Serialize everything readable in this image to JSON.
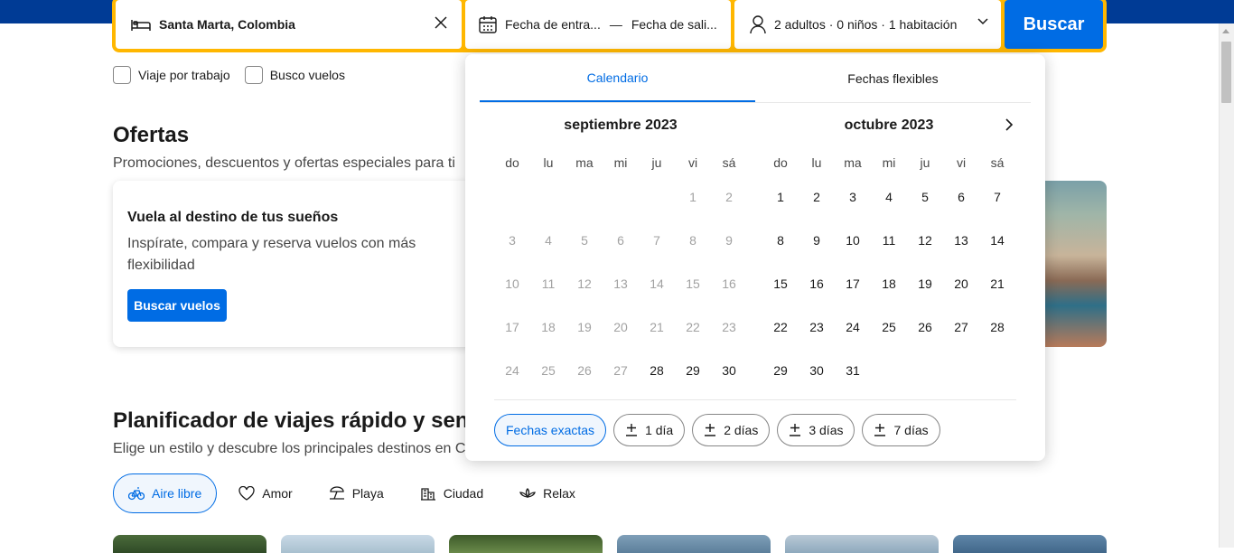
{
  "search": {
    "destination": "Santa Marta, Colombia",
    "checkin": "Fecha de entra...",
    "separator": "—",
    "checkout": "Fecha de sali...",
    "guests": "2 adultos · 0 niños · 1 habitación",
    "button": "Buscar",
    "icons": [
      "bed-icon",
      "close-icon",
      "calendar-icon",
      "person-icon",
      "chevron-down-icon"
    ]
  },
  "options": {
    "work_trip": "Viaje por trabajo",
    "flights": "Busco vuelos"
  },
  "offers": {
    "title": "Ofertas",
    "subtitle": "Promociones, descuentos y ofertas especiales para ti",
    "card_title": "Vuela al destino de tus sueños",
    "card_text": "Inspírate, compara y reserva vuelos con más flexibilidad",
    "card_button": "Buscar vuelos"
  },
  "planner": {
    "title": "Planificador de viajes rápido y senc",
    "subtitle": "Elige un estilo y descubre los principales destinos en Co",
    "chips": [
      "Aire libre",
      "Amor",
      "Playa",
      "Ciudad",
      "Relax"
    ]
  },
  "calendar": {
    "tabs": [
      "Calendario",
      "Fechas flexibles"
    ],
    "weekdays": [
      "do",
      "lu",
      "ma",
      "mi",
      "ju",
      "vi",
      "sá"
    ],
    "months": [
      {
        "title": "septiembre 2023",
        "leading_blank": 5,
        "days": 30,
        "past_until": 27
      },
      {
        "title": "octubre 2023",
        "leading_blank": 0,
        "days": 31,
        "past_until": 0
      }
    ],
    "flex_options": [
      "Fechas exactas",
      "1 día",
      "2 días",
      "3 días",
      "7 días"
    ]
  },
  "colors": {
    "header": "#003b95",
    "accent": "#006ce4",
    "search_border": "#ffb700"
  }
}
